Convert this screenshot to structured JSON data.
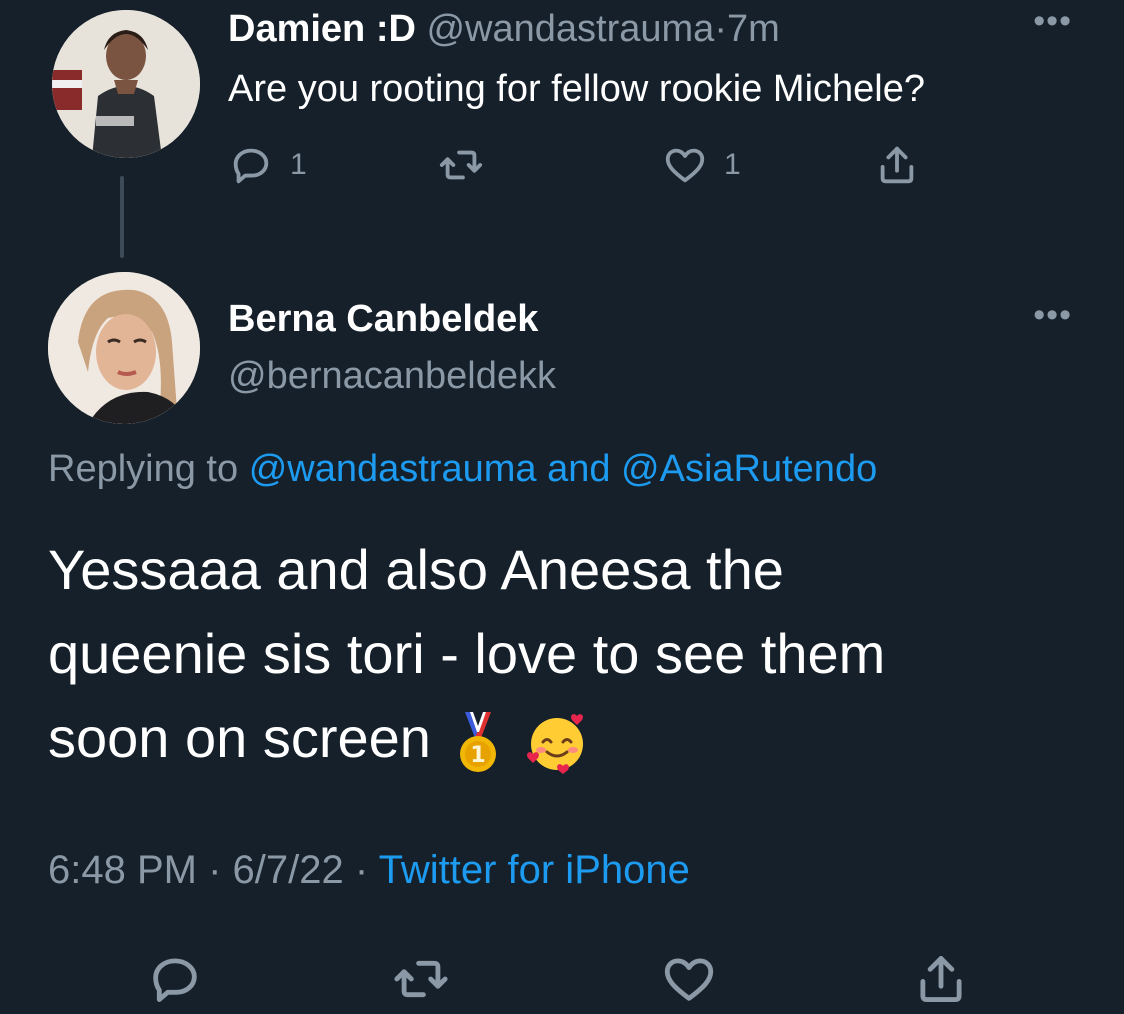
{
  "parent_tweet": {
    "display_name": "Damien :D",
    "handle": "@wandastrauma",
    "separator": "·",
    "time_ago": "7m",
    "text": "Are you rooting for fellow rookie Michele?",
    "reply_count": "1",
    "like_count": "1",
    "more_icon": "more-dots-icon"
  },
  "main_tweet": {
    "display_name": "Berna Canbeldek",
    "handle": "@bernacanbeldekk",
    "replying_prefix": "Replying to",
    "reply_to_1": "@wandastrauma",
    "reply_and": "and",
    "reply_to_2": "@AsiaRutendo",
    "text_line_1": "Yessaaa and also Aneesa the",
    "text_line_2": "queenie sis tori - love to see them",
    "text_line_3": "soon on screen",
    "time": "6:48 PM",
    "dot": "·",
    "date": "6/7/22",
    "source": "Twitter for iPhone"
  },
  "colors": {
    "background": "#15202b",
    "text": "#ffffff",
    "muted": "#8b98a5",
    "link": "#1d9bf0"
  },
  "icons": [
    "reply-icon",
    "retweet-icon",
    "like-icon",
    "share-icon",
    "medal-emoji",
    "smiling-face-with-hearts-emoji"
  ]
}
